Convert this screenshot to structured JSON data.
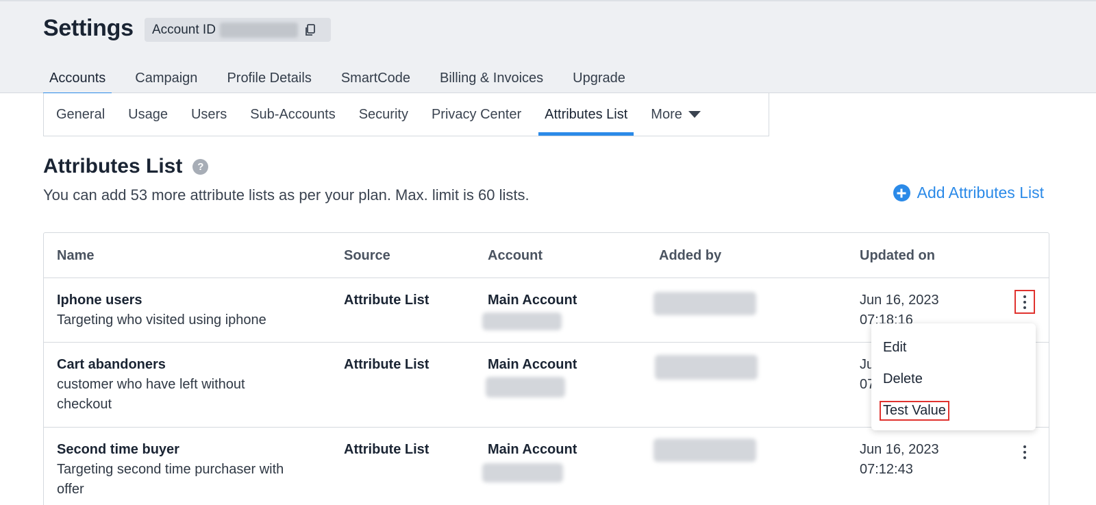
{
  "header": {
    "title": "Settings",
    "account_id_label": "Account ID",
    "copy_icon": "copy-icon"
  },
  "top_tabs": [
    {
      "label": "Accounts",
      "active": true
    },
    {
      "label": "Campaign"
    },
    {
      "label": "Profile Details"
    },
    {
      "label": "SmartCode"
    },
    {
      "label": "Billing & Invoices"
    },
    {
      "label": "Upgrade"
    }
  ],
  "sub_tabs": [
    {
      "label": "General"
    },
    {
      "label": "Usage"
    },
    {
      "label": "Users"
    },
    {
      "label": "Sub-Accounts"
    },
    {
      "label": "Security"
    },
    {
      "label": "Privacy Center"
    },
    {
      "label": "Attributes List",
      "active": true
    },
    {
      "label": "More"
    }
  ],
  "section": {
    "title": "Attributes List",
    "help_icon": "?",
    "subtitle": "You can add 53 more attribute lists as per your plan. Max. limit is 60 lists.",
    "add_label": "Add Attributes List"
  },
  "table": {
    "columns": [
      "Name",
      "Source",
      "Account",
      "Added by",
      "Updated on"
    ],
    "rows": [
      {
        "name": "Iphone users",
        "description": "Targeting who visited using iphone",
        "source": "Attribute List",
        "account": "Main Account",
        "updated_date": "Jun 16, 2023",
        "updated_time": "07:18:16"
      },
      {
        "name": "Cart abandoners",
        "description": "customer who have left without",
        "description_2": "checkout",
        "source": "Attribute List",
        "account": "Main Account",
        "updated_date": "Ju",
        "updated_time": "07"
      },
      {
        "name": "Second time buyer",
        "description": "Targeting second time purchaser with",
        "description_2": "offer",
        "source": "Attribute List",
        "account": "Main Account",
        "updated_date": "Jun 16, 2023",
        "updated_time": "07:12:43"
      }
    ]
  },
  "row_menu": {
    "items": [
      "Edit",
      "Delete",
      "Test Value"
    ]
  },
  "colors": {
    "accent": "#2b8ae8",
    "highlight": "#e0322e"
  }
}
